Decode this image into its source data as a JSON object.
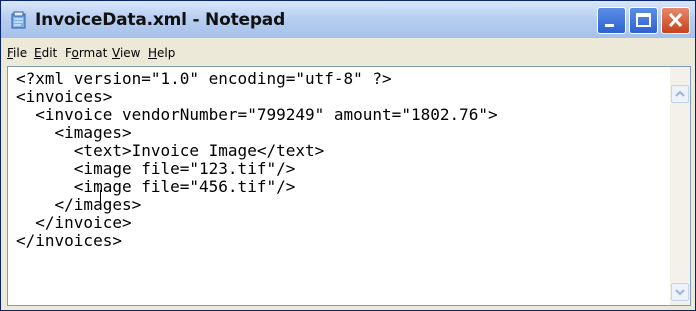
{
  "window": {
    "title": "InvoiceData.xml - Notepad",
    "icon": "notepad-icon"
  },
  "title_buttons": [
    "minimize-icon",
    "maximize-icon",
    "close-icon"
  ],
  "menu": {
    "items": [
      {
        "prefix": "",
        "mnemonic": "F",
        "rest": "ile"
      },
      {
        "prefix": "",
        "mnemonic": "E",
        "rest": "dit"
      },
      {
        "prefix": "F",
        "mnemonic": "o",
        "rest": "rmat"
      },
      {
        "prefix": "",
        "mnemonic": "V",
        "rest": "iew"
      },
      {
        "prefix": "",
        "mnemonic": "H",
        "rest": "elp"
      }
    ]
  },
  "editor": {
    "content": "<?xml version=\"1.0\" encoding=\"utf-8\" ?>\n<invoices>\n  <invoice vendorNumber=\"799249\" amount=\"1802.76\">\n    <images>\n      <text>Invoice Image</text>\n      <image file=\"123.tif\"/>\n      <image file=\"456.tif\"/>\n    </images>\n  </invoice>\n</invoices>"
  },
  "colors": {
    "titlebar": "#b9cff0",
    "close_button": "#c8401c",
    "window_buttons": "#2d62d2"
  }
}
